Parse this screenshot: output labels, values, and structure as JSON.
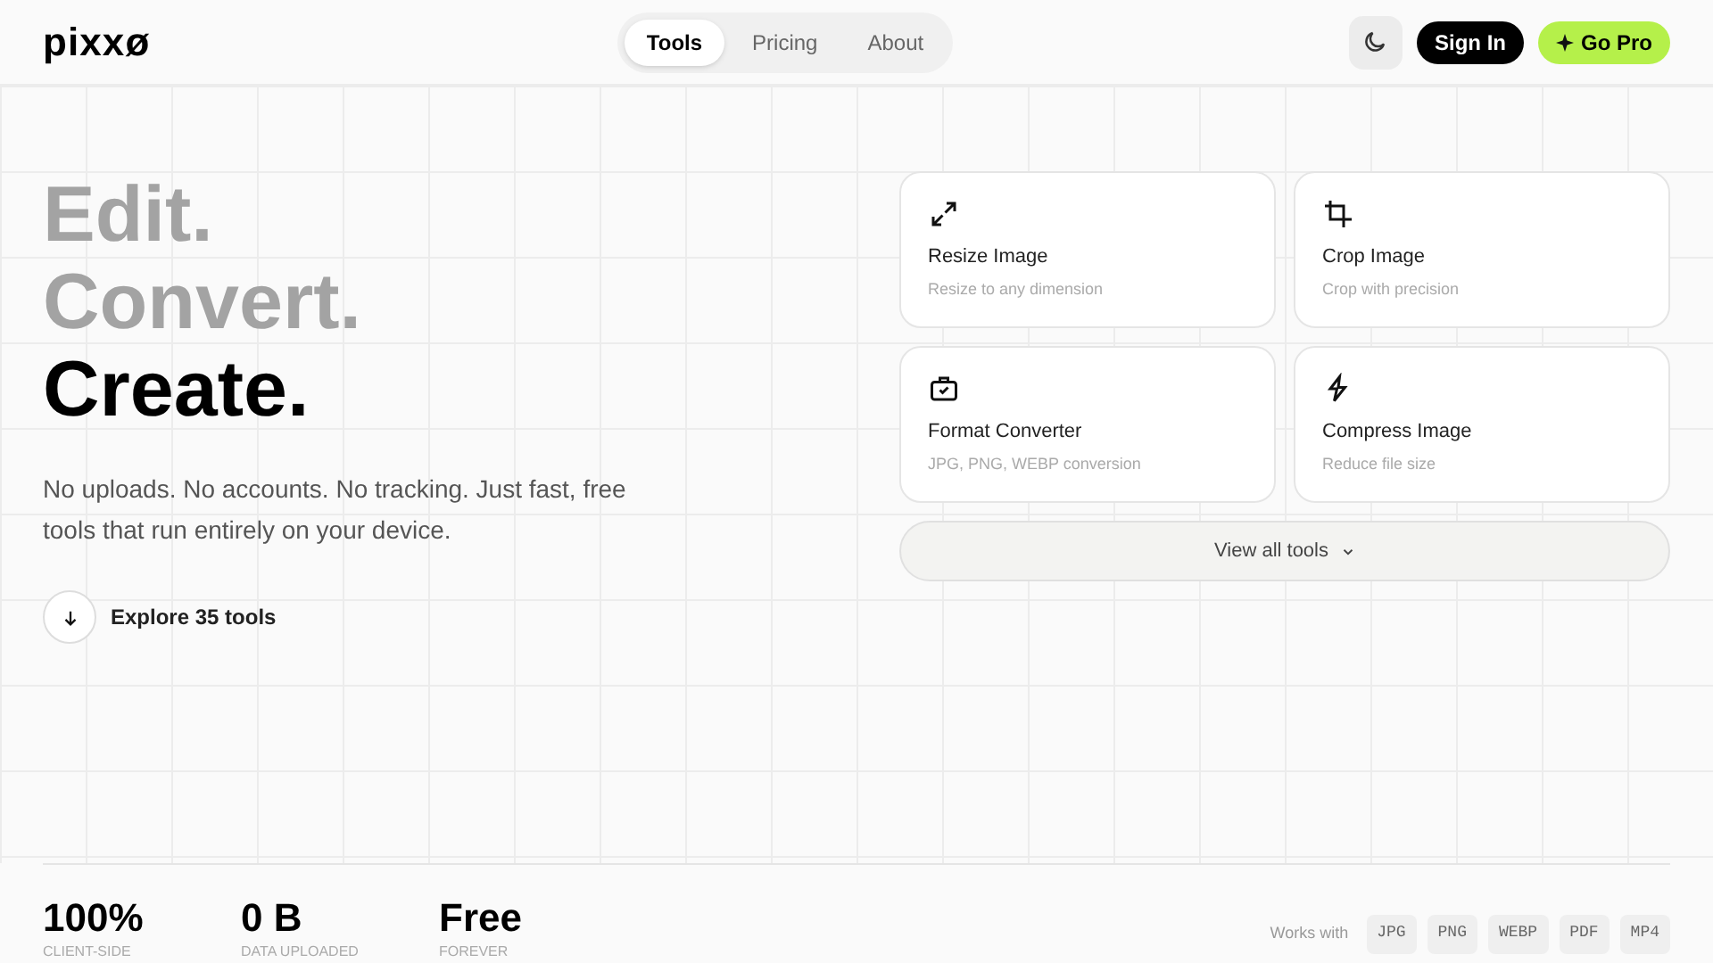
{
  "logo": "pixxø",
  "nav": [
    {
      "label": "Tools",
      "selected": true
    },
    {
      "label": "Pricing",
      "selected": false
    },
    {
      "label": "About",
      "selected": false
    }
  ],
  "actions": {
    "sign_in": "Sign In",
    "go_pro": "Go Pro"
  },
  "headline": [
    {
      "text": "Edit.",
      "muted": true
    },
    {
      "text": "Convert.",
      "muted": true
    },
    {
      "text": "Create.",
      "muted": false
    }
  ],
  "tagline": "No uploads. No accounts. No tracking. Just fast, free tools that run entirely on your device.",
  "explore": "Explore 35 tools",
  "tools": [
    {
      "kind": "resize",
      "title": "Resize Image",
      "subtitle": "Resize to any dimension"
    },
    {
      "kind": "crop",
      "title": "Crop Image",
      "subtitle": "Crop with precision"
    },
    {
      "kind": "convert",
      "title": "Format Converter",
      "subtitle": "JPG, PNG, WEBP conversion"
    },
    {
      "kind": "compress",
      "title": "Compress Image",
      "subtitle": "Reduce file size"
    }
  ],
  "view_all": "View all tools",
  "stats": [
    {
      "value": "100%",
      "label": "CLIENT-SIDE"
    },
    {
      "value": "0 B",
      "label": "DATA UPLOADED"
    },
    {
      "value": "Free",
      "label": "FOREVER"
    }
  ],
  "works_with": {
    "label": "Works with",
    "formats": [
      "JPG",
      "PNG",
      "WEBP",
      "PDF",
      "MP4"
    ]
  }
}
